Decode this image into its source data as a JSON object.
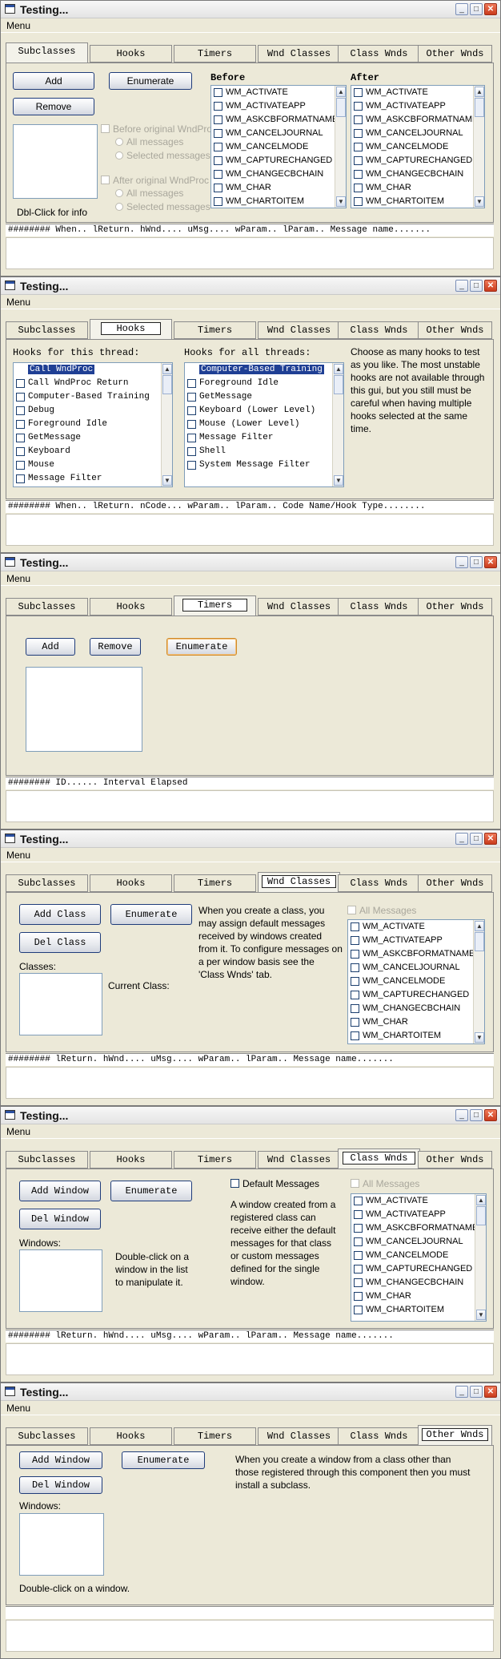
{
  "window_title": "Testing...",
  "menu_label": "Menu",
  "tabs": [
    "Subclasses",
    "Hooks",
    "Timers",
    "Wnd Classes",
    "Class Wnds",
    "Other Wnds"
  ],
  "messages": [
    "WM_ACTIVATE",
    "WM_ACTIVATEAPP",
    "WM_ASKCBFORMATNAME",
    "WM_CANCELJOURNAL",
    "WM_CANCELMODE",
    "WM_CAPTURECHANGED",
    "WM_CHANGECBCHAIN",
    "WM_CHAR",
    "WM_CHARTOITEM"
  ],
  "subclasses": {
    "add": "Add",
    "enumerate": "Enumerate",
    "remove": "Remove",
    "before_header": "Before",
    "after_header": "After",
    "before_original": "Before original WndProc",
    "after_original": "After original WndProc",
    "all_messages": "All messages",
    "selected_messages": "Selected messages",
    "dbl_click_info": "Dbl-Click for info",
    "status": "######## When.. lReturn. hWnd.... uMsg.... wParam.. lParam.. Message name......."
  },
  "hooks": {
    "this_thread_label": "Hooks for this thread:",
    "all_threads_label": "Hooks for all threads:",
    "this_thread_items": [
      "Call WndProc",
      "Call WndProc Return",
      "Computer-Based Training",
      "Debug",
      "Foreground Idle",
      "GetMessage",
      "Keyboard",
      "Mouse",
      "Message Filter"
    ],
    "all_threads_items": [
      "Computer-Based Training",
      "Foreground Idle",
      "GetMessage",
      "Keyboard (Lower Level)",
      "Mouse (Lower Level)",
      "Message Filter",
      "Shell",
      "System Message Filter"
    ],
    "description": "Choose as many hooks to test as you like.  The most unstable hooks are not available through this gui, but you still must be careful when having multiple hooks selected at the same time.",
    "status": "######## When.. lReturn. nCode... wParam.. lParam.. Code Name/Hook Type........"
  },
  "timers": {
    "add": "Add",
    "remove": "Remove",
    "enumerate": "Enumerate",
    "status": "######## ID...... Interval Elapsed"
  },
  "wnd_classes": {
    "add_class": "Add Class",
    "enumerate": "Enumerate",
    "del_class": "Del Class",
    "classes_label": "Classes:",
    "current_class_label": "Current Class:",
    "description": "When you create a class, you may assign default messages received by windows created from it.  To configure messages on a per window basis see the 'Class Wnds' tab.",
    "all_messages": "All Messages",
    "status": "######## lReturn. hWnd.... uMsg.... wParam.. lParam.. Message name......."
  },
  "class_wnds": {
    "add_window": "Add Window",
    "enumerate": "Enumerate",
    "del_window": "Del Window",
    "windows_label": "Windows:",
    "double_click_hint": "Double-click on a window in the list to manipulate it.",
    "default_messages": "Default Messages",
    "all_messages": "All Messages",
    "description": "A window created from a registered class can receive either the default messages for that class or custom messages defined for the single window.",
    "status": "######## lReturn. hWnd.... uMsg.... wParam.. lParam.. Message name......."
  },
  "other_wnds": {
    "add_window": "Add Window",
    "enumerate": "Enumerate",
    "del_window": "Del Window",
    "windows_label": "Windows:",
    "double_click_hint": "Double-click on a window.",
    "description": "When you create a window from a class other than those registered through this component then you must install a subclass."
  }
}
